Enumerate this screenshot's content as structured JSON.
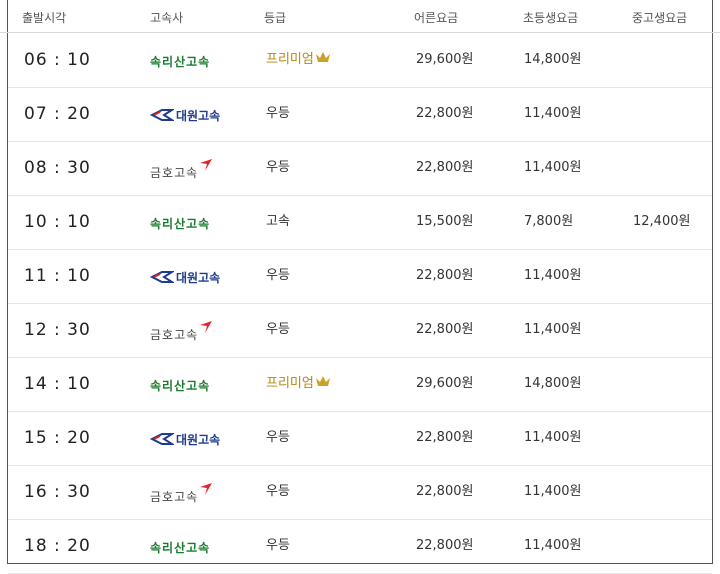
{
  "columns": {
    "time": "출발시각",
    "company": "고속사",
    "grade": "등급",
    "adult": "어른요금",
    "child": "초등생요금",
    "teen": "중고생요금"
  },
  "companies": {
    "songnisan": "속리산고속",
    "daewon": "대원고속",
    "kumho": "금호고속"
  },
  "icons": {
    "premium": "crown-icon",
    "kumho": "kumho-wing-icon",
    "daewon": "kd-logo-icon"
  },
  "colors": {
    "songnisan": "#1a7a2e",
    "daewon": "#1f3b8f",
    "kumho_wing": "#e0262b",
    "premium": "#b8860b"
  },
  "rows": [
    {
      "time": "06 : 10",
      "company": "songnisan",
      "grade": "프리미엄",
      "premium": true,
      "adult": "29,600원",
      "child": "14,800원",
      "teen": ""
    },
    {
      "time": "07 : 20",
      "company": "daewon",
      "grade": "우등",
      "premium": false,
      "adult": "22,800원",
      "child": "11,400원",
      "teen": ""
    },
    {
      "time": "08 : 30",
      "company": "kumho",
      "grade": "우등",
      "premium": false,
      "adult": "22,800원",
      "child": "11,400원",
      "teen": ""
    },
    {
      "time": "10 : 10",
      "company": "songnisan",
      "grade": "고속",
      "premium": false,
      "adult": "15,500원",
      "child": "7,800원",
      "teen": "12,400원"
    },
    {
      "time": "11 : 10",
      "company": "daewon",
      "grade": "우등",
      "premium": false,
      "adult": "22,800원",
      "child": "11,400원",
      "teen": ""
    },
    {
      "time": "12 : 30",
      "company": "kumho",
      "grade": "우등",
      "premium": false,
      "adult": "22,800원",
      "child": "11,400원",
      "teen": ""
    },
    {
      "time": "14 : 10",
      "company": "songnisan",
      "grade": "프리미엄",
      "premium": true,
      "adult": "29,600원",
      "child": "14,800원",
      "teen": ""
    },
    {
      "time": "15 : 20",
      "company": "daewon",
      "grade": "우등",
      "premium": false,
      "adult": "22,800원",
      "child": "11,400원",
      "teen": ""
    },
    {
      "time": "16 : 30",
      "company": "kumho",
      "grade": "우등",
      "premium": false,
      "adult": "22,800원",
      "child": "11,400원",
      "teen": ""
    },
    {
      "time": "18 : 20",
      "company": "songnisan",
      "grade": "우등",
      "premium": false,
      "adult": "22,800원",
      "child": "11,400원",
      "teen": ""
    }
  ]
}
